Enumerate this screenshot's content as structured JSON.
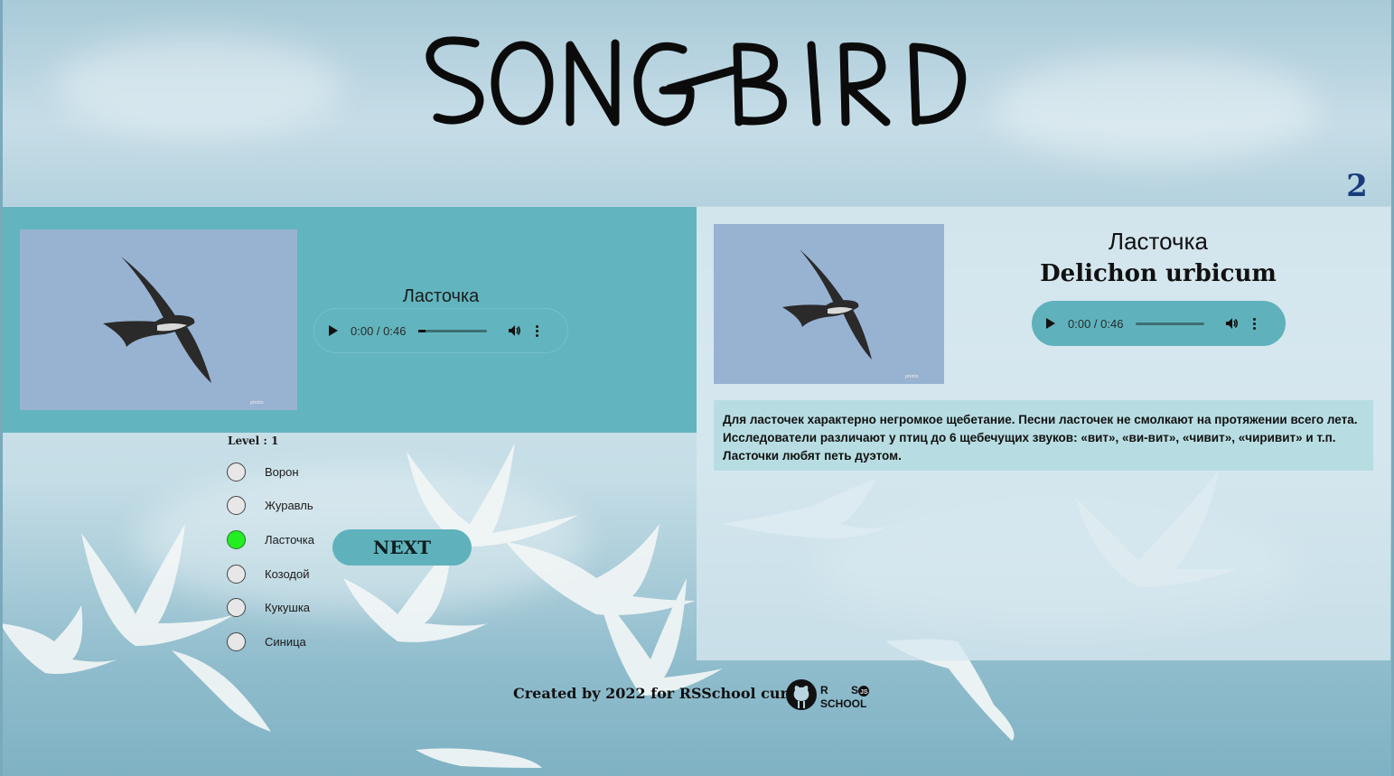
{
  "app": {
    "logo_text": "SONGBIRD",
    "score": "2"
  },
  "question": {
    "name": "Ласточка",
    "image_alt": "bird",
    "audio": {
      "time": "0:00 / 0:46"
    }
  },
  "level": {
    "label": "Level : 1"
  },
  "answers": [
    {
      "label": "Ворон",
      "state": "default"
    },
    {
      "label": "Журавль",
      "state": "default"
    },
    {
      "label": "Ласточка",
      "state": "correct"
    },
    {
      "label": "Козодой",
      "state": "default"
    },
    {
      "label": "Кукушка",
      "state": "default"
    },
    {
      "label": "Синица",
      "state": "default"
    }
  ],
  "next_button": {
    "label": "NEXT"
  },
  "info": {
    "name": "Ласточка",
    "latin": "Delichon urbicum",
    "audio": {
      "time": "0:00 / 0:46"
    },
    "description": "Для ласточек характерно негромкое щебетание. Песни ласточек не смолкают на протяжении всего лета. Исследователи различают у птиц до 6 щебечущих звуков: «вит», «ви-вит», «чивит», «чиривит» и т.п. Ласточки любят петь дуэтом."
  },
  "footer": {
    "text": "Created by 2022 for RSSchool curses",
    "rs_logo_text": "RS SCHOOL JS"
  },
  "colors": {
    "panel_teal": "#62b5be",
    "correct_green": "#22ee22",
    "score_blue": "#1a3c7a"
  }
}
